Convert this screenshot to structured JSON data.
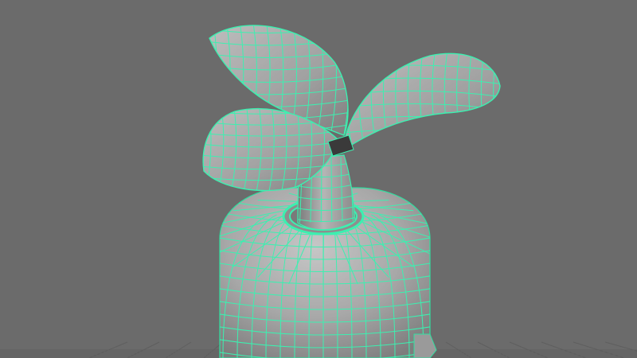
{
  "viewport": {
    "name": "3d-modeling-viewport",
    "background_color": "#6b6b6b",
    "grid_color": "#5f5f5f",
    "wireframe_color": "#3cf0b0",
    "model_shading_color": "#a9a9a9"
  },
  "scene": {
    "object": "wireframe-mesh",
    "parts": [
      "base-body",
      "neck-ring",
      "stem",
      "left-leaf",
      "right-leaf",
      "front-leaf"
    ]
  }
}
